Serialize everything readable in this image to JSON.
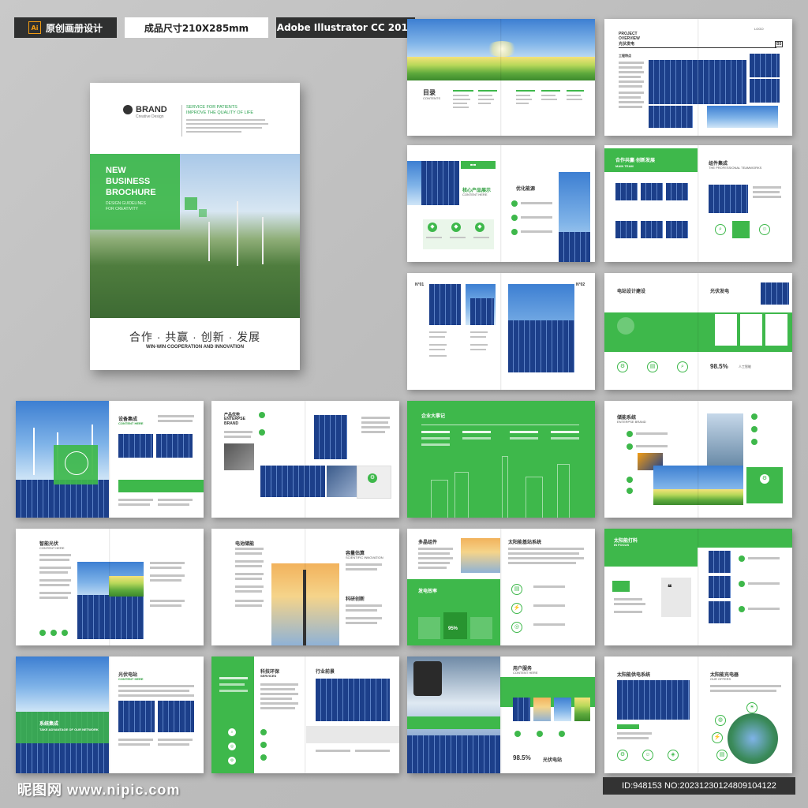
{
  "header": {
    "tag": "原创画册设计",
    "size": "成品尺寸210X285mm",
    "software": "Adobe Illustrator CC 2018",
    "ai_badge": "Ai"
  },
  "cover": {
    "brand": "BRAND",
    "brand_sub": "Creative Design",
    "service_line1": "SERVICE FOR PATIENTS",
    "service_line2": "IMPROVE THE QUALITY OF LIFE",
    "title_line1": "NEW",
    "title_line2": "BUSINESS",
    "title_line3": "BROCHURE",
    "design_line1": "DESIGN GUIDELINES",
    "design_line2": "FOR CREATIVITY",
    "slogan": "合作 · 共赢 · 创新 · 发展",
    "slogan_en": "WIN-WIN COOPERATION AND INNOVATION"
  },
  "spreads": {
    "s1": {
      "title": "目录",
      "sub": "CONTENTS"
    },
    "s2": {
      "line1": "PROJECT",
      "line2": "OVERVIEW",
      "title": "光伏发电",
      "tag": "LOGO",
      "badge": "B5",
      "label": "工程特点"
    },
    "s3": {
      "title": "核心产品展示",
      "sub": "CONTENT HERE",
      "title2": "优化能源"
    },
    "s4": {
      "title": "合作共赢·创新发展",
      "sub": "MAIN TEAM",
      "title2": "组件集成",
      "sub2": "THE PROFESSIONAL TEAMWORKS"
    },
    "s5": {
      "n1": "N°01",
      "n2": "N°02"
    },
    "s6": {
      "title": "电站设计建设",
      "title2": "光伏发电",
      "stat": "98.5%",
      "stat_label": "人工智能"
    },
    "s7": {
      "title": "设备集成",
      "sub": "CONTENT HERE"
    },
    "s8": {
      "title": "产品优势",
      "sub": "ENTERPSE",
      "sub2": "BRAND"
    },
    "s9": {
      "title": "企业大事记"
    },
    "s10": {
      "title": "储能系统",
      "sub": "ENTERPSE BRAND"
    },
    "s11": {
      "title": "智能光伏",
      "sub": "CONTENT HERE"
    },
    "s12": {
      "title": "电池储能",
      "title2": "容量估算",
      "sub2": "SCIENTIFIC INNOVATION",
      "title3": "科研创新"
    },
    "s13": {
      "title": "多晶组件",
      "title2": "太阳能基站系统",
      "panel": "发电效率",
      "stat": "95%"
    },
    "s14": {
      "title": "太阳能打料",
      "sub": "IN FOCUS"
    },
    "s15": {
      "title": "光伏电站",
      "sub": "CONTENT HERE",
      "title2": "系统集成",
      "sub2": "TAKE ADVANTAGE OF OUR NETWORK"
    },
    "s16": {
      "title": "科技环保",
      "sub": "SERVICES",
      "title2": "行业前景"
    },
    "s17": {
      "title": "用户服务",
      "sub": "CONTENT HERE",
      "stat": "98.5%",
      "stat_label": "光伏电站"
    },
    "s18": {
      "title": "太阳能供电系统",
      "title2": "太阳能充电器",
      "sub2": "OUR OFFERS"
    }
  },
  "footer": {
    "watermark": "昵图网 www.nipic.com",
    "id_text": "ID:948153 NO:20231230124809104122"
  },
  "colors": {
    "accent": "#3eb84b",
    "dark": "#2f3030"
  }
}
